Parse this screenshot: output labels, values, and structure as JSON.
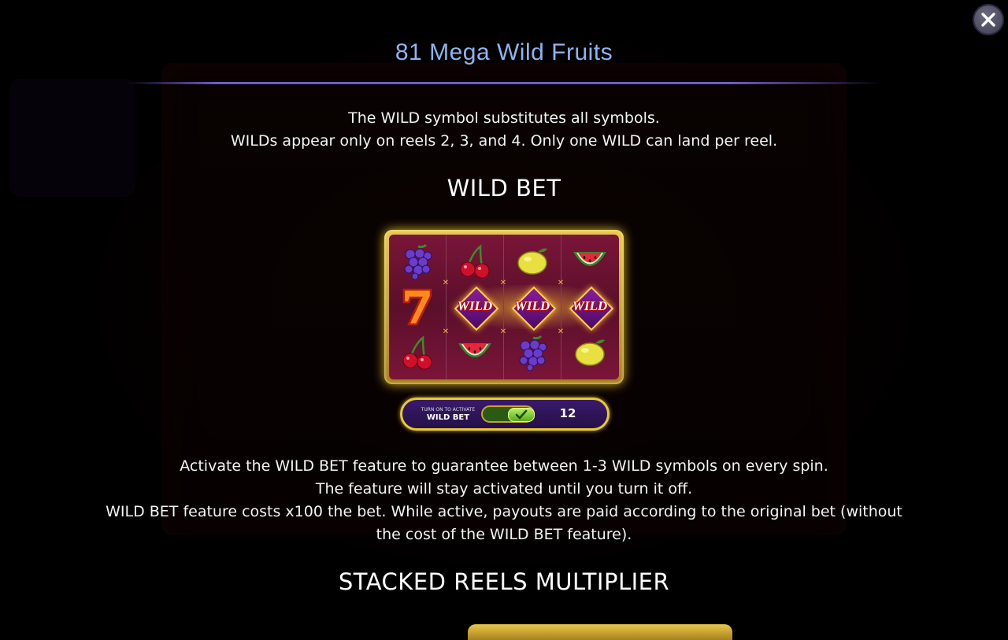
{
  "title": "81 Mega Wild Fruits",
  "intro": {
    "line1": "The WILD symbol substitutes all symbols.",
    "line2": "WILDs appear only on reels 2, 3, and 4. Only one WILD can land per reel."
  },
  "wild_bet_heading": "WILD BET",
  "reels": {
    "wild_text": "WILD",
    "columns": [
      [
        "grapes",
        "seven",
        "cherry"
      ],
      [
        "cherry",
        "wild",
        "watermelon"
      ],
      [
        "lemon",
        "wild",
        "grapes"
      ],
      [
        "watermelon",
        "wild",
        "lemon"
      ]
    ]
  },
  "wild_bet_widget": {
    "small_label": "TURN ON TO ACTIVATE",
    "big_label": "WILD BET",
    "value": "12",
    "toggle_on": true
  },
  "description": {
    "line1": "Activate the WILD BET feature to guarantee between 1-3 WILD symbols on every spin.",
    "line2": "The feature will stay activated until you turn it off.",
    "line3": "WILD BET feature costs x100 the bet. While active, payouts are paid according to the original bet (without",
    "line4": "the cost of the WILD BET feature)."
  },
  "stacked_heading": "STACKED REELS MULTIPLIER",
  "colors": {
    "title": "#8fb4ee",
    "rule": "#6d5ccc",
    "gold": "#e7c83a",
    "reel_bg": "#7a1538"
  },
  "icons": {
    "close": "close-icon",
    "check": "check-icon"
  }
}
